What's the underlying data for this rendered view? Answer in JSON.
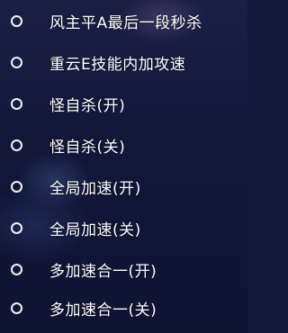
{
  "menu": {
    "items": [
      {
        "label": "风主平A最后一段秒杀"
      },
      {
        "label": "重云E技能内加攻速"
      },
      {
        "label": "怪自杀(开)"
      },
      {
        "label": "怪自杀(关)"
      },
      {
        "label": "全局加速(开)"
      },
      {
        "label": "全局加速(关)"
      },
      {
        "label": "多加速合一(开)"
      },
      {
        "label": "多加速合一(关)"
      }
    ]
  },
  "colors": {
    "background": "#12183a",
    "text": "#ffffff",
    "radio_border": "#f2f2f5"
  },
  "icons": {
    "option_marker": "radio-circle-icon"
  }
}
